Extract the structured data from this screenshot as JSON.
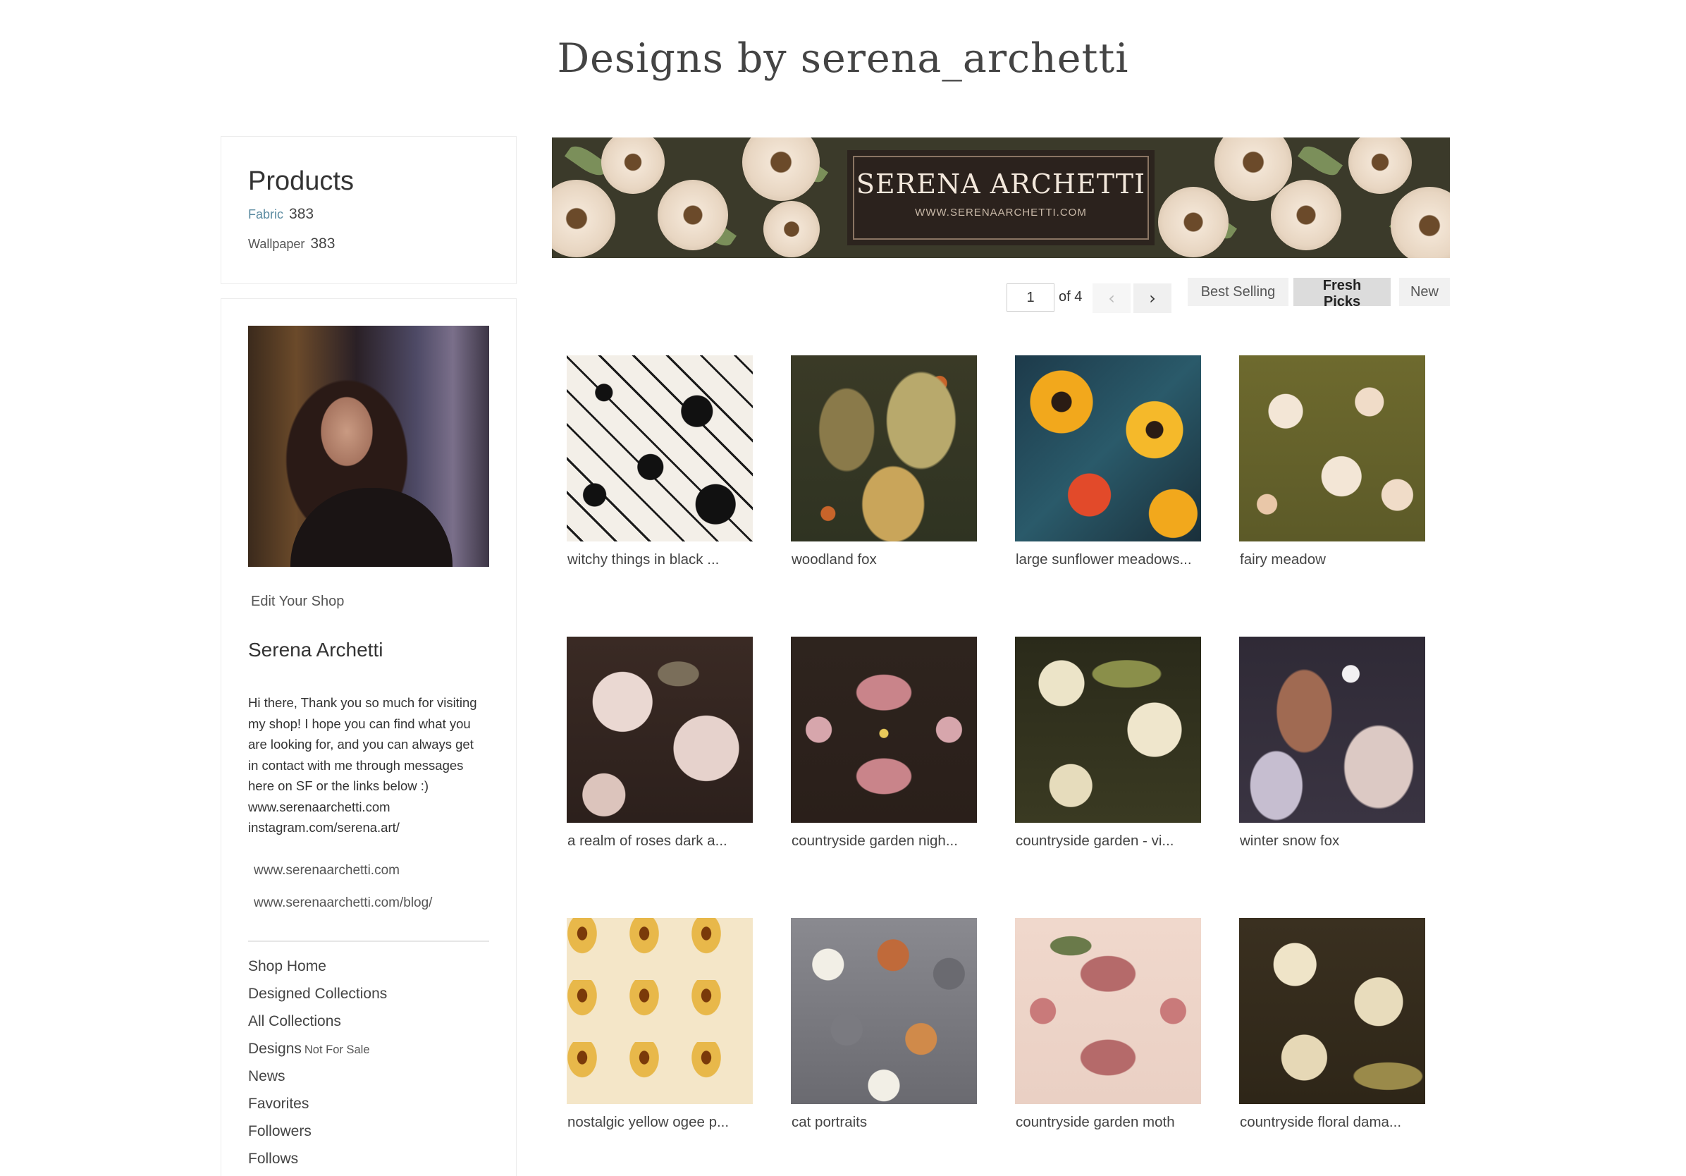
{
  "page": {
    "title": "Designs by serena_archetti"
  },
  "products": {
    "title": "Products",
    "items": [
      {
        "label": "Fabric",
        "count": "383"
      },
      {
        "label": "Wallpaper",
        "count": "383"
      }
    ]
  },
  "profile": {
    "edit_label": "Edit Your Shop",
    "name": "Serena Archetti",
    "bio": "Hi there, Thank you so much for visiting\nmy shop! I hope you can find what you\nare looking for, and you can always get\nin contact with me through messages\nhere on SF or the links below :)\nwww.serenaarchetti.com\ninstagram.com/serena.art/",
    "links": [
      "www.serenaarchetti.com",
      "www.serenaarchetti.com/blog/"
    ]
  },
  "nav": {
    "items": [
      {
        "label": "Shop Home",
        "suffix": ""
      },
      {
        "label": "Designed Collections",
        "suffix": ""
      },
      {
        "label": "All Collections",
        "suffix": ""
      },
      {
        "label": "Designs",
        "suffix": "Not For Sale"
      },
      {
        "label": "News",
        "suffix": ""
      },
      {
        "label": "Favorites",
        "suffix": ""
      },
      {
        "label": "Followers",
        "suffix": ""
      },
      {
        "label": "Follows",
        "suffix": ""
      }
    ]
  },
  "banner": {
    "name": "SERENA ARCHETTI",
    "url": "WWW.SERENAARCHETTI.COM"
  },
  "pagination": {
    "current": "1",
    "of_label": "of 4",
    "prev_icon": "chevron-left-icon",
    "next_icon": "chevron-right-icon"
  },
  "sort": {
    "options": [
      "Best Selling",
      "Fresh Picks",
      "New"
    ],
    "active": "Fresh Picks"
  },
  "designs": [
    "witchy things in black ...",
    "woodland fox",
    "large sunflower meadows...",
    "fairy meadow",
    "a realm of roses dark a...",
    "countryside garden nigh...",
    "countryside garden - vi...",
    "winter snow fox",
    "nostalgic yellow ogee p...",
    "cat portraits",
    "countryside garden moth",
    "countryside floral dama..."
  ],
  "colors": {
    "link_accent": "#5a8aa0",
    "active_sort_bg": "#dcdcdc",
    "banner_bg": "#3b3a2a"
  }
}
